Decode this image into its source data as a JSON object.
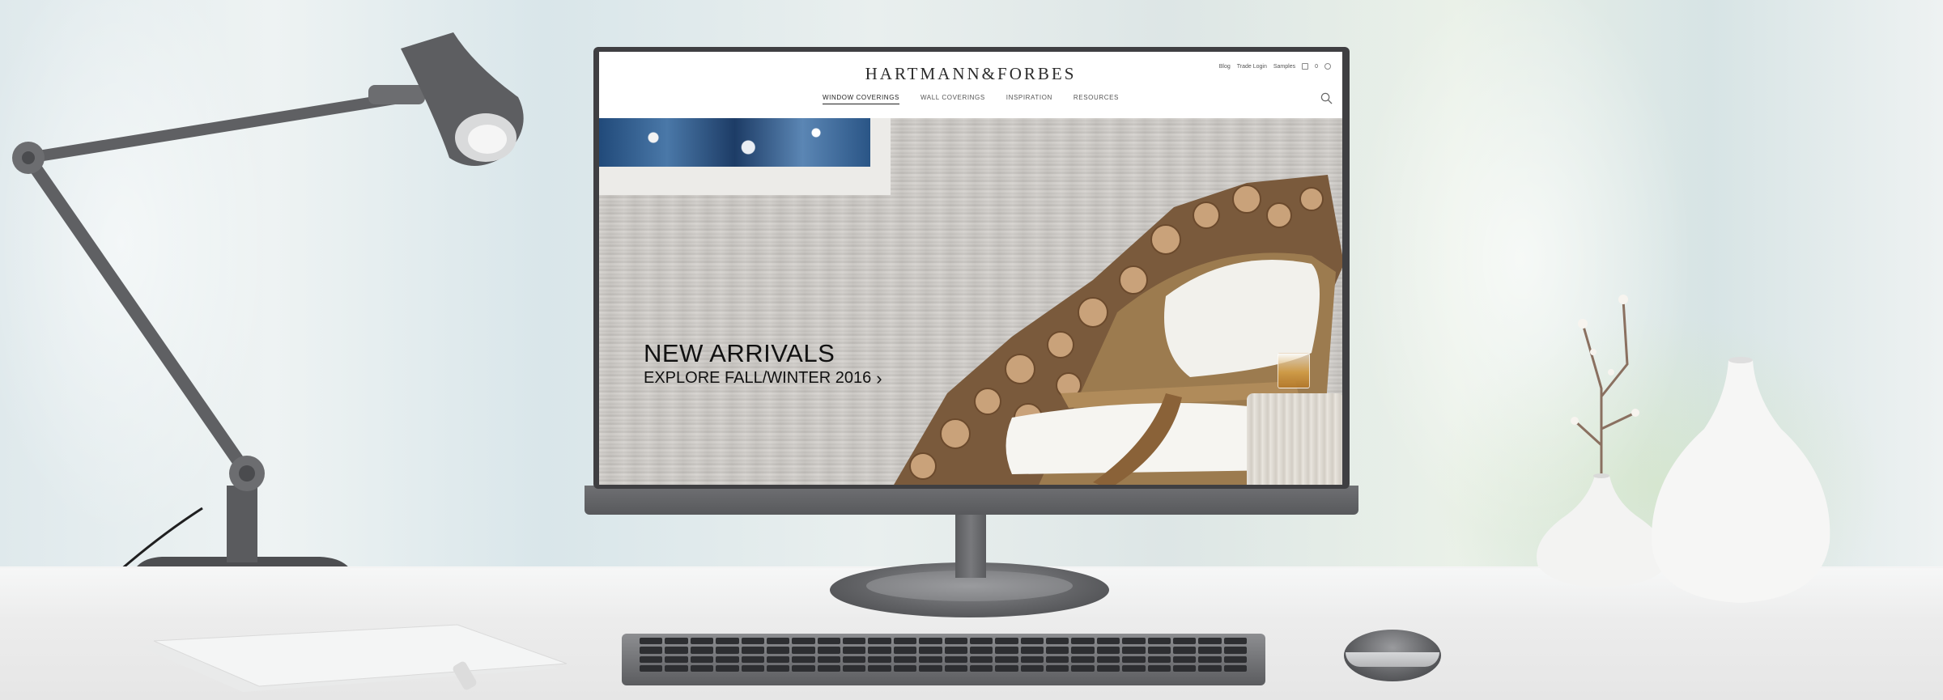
{
  "site": {
    "brand": "HARTMANN&FORBES",
    "utility": [
      "Blog",
      "Trade Login",
      "Samples"
    ],
    "cart_count": "0",
    "nav": [
      {
        "label": "WINDOW COVERINGS",
        "active": true
      },
      {
        "label": "WALL COVERINGS",
        "active": false
      },
      {
        "label": "INSPIRATION",
        "active": false
      },
      {
        "label": "RESOURCES",
        "active": false
      }
    ],
    "hero": {
      "title": "NEW ARRIVALS",
      "link": "EXPLORE FALL/WINTER 2016"
    }
  },
  "icons": {
    "search": "search-icon",
    "cart": "cart-icon",
    "account": "account-icon",
    "chevron": "chevron-right-icon"
  },
  "colors": {
    "brand_text": "#2c2c2c",
    "monitor": "#3f3f42",
    "desk": "#ececec"
  }
}
